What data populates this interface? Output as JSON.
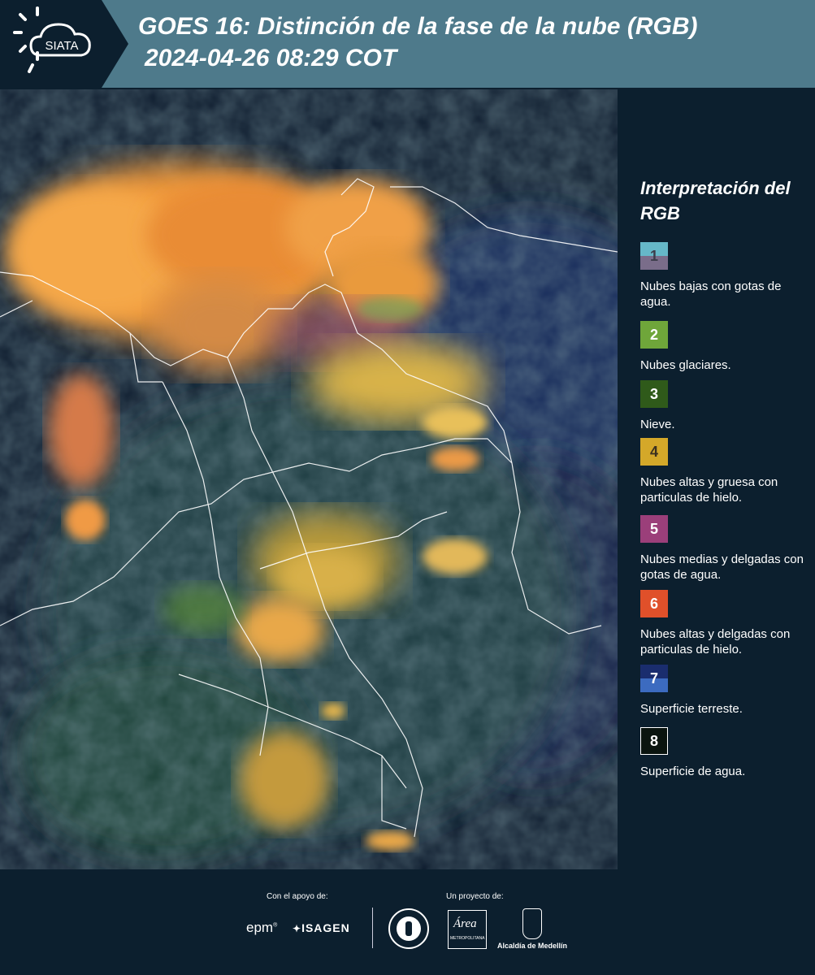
{
  "header": {
    "logo_text": "SIATA",
    "title": "GOES 16: Distinción de la fase de la nube (RGB)",
    "timestamp": "2024-04-26 08:29 COT"
  },
  "map": {
    "icon": "satellite-rgb-image"
  },
  "legend": {
    "title": "Interpretación del RGB",
    "items": [
      {
        "num": "1",
        "label": "Nubes bajas con gotas de agua.",
        "color_top": "#66b8c8",
        "color_bottom": "#7a6d8a"
      },
      {
        "num": "2",
        "label": "Nubes glaciares.",
        "color": "#6fa63a"
      },
      {
        "num": "3",
        "label": "Nieve.",
        "color": "#2f5a1a"
      },
      {
        "num": "4",
        "label": "Nubes altas y gruesa con particulas de hielo.",
        "color": "#d4a829"
      },
      {
        "num": "5",
        "label": "Nubes medias y delgadas con gotas de agua.",
        "color": "#9b3f7a"
      },
      {
        "num": "6",
        "label": "Nubes altas y delgadas con particulas de hielo.",
        "color": "#e0502a"
      },
      {
        "num": "7",
        "label": "Superficie terreste.",
        "color_top": "#1a2d6e",
        "color_bottom": "#3c6bc0"
      },
      {
        "num": "8",
        "label": "Superficie de agua.",
        "color": "#0a140f"
      }
    ]
  },
  "footer": {
    "support_label": "Con el apoyo de:",
    "project_label": "Un proyecto de:",
    "epm": "epm",
    "isagen": "ISAGEN",
    "area_metro": "Área",
    "area_metro_sub": "METROPOLITANA",
    "alcaldia": "Alcaldía de Medellín"
  }
}
